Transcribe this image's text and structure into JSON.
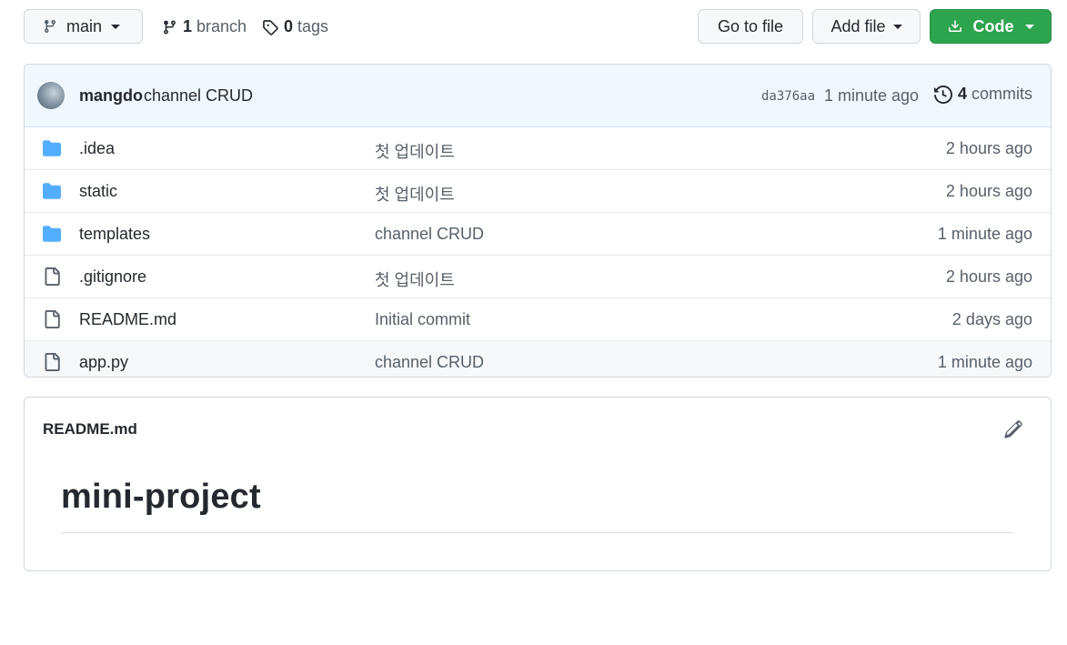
{
  "toolbar": {
    "branch_label": "main",
    "branches_count": "1",
    "branches_label": "branch",
    "tags_count": "0",
    "tags_label": "tags",
    "goto_file_label": "Go to file",
    "add_file_label": "Add file",
    "code_label": "Code"
  },
  "commit": {
    "author": "mangdo",
    "message": "channel CRUD",
    "sha": "da376aa",
    "time": "1 minute ago",
    "count": "4",
    "count_label": "commits"
  },
  "files": [
    {
      "type": "folder",
      "name": ".idea",
      "message": "첫 업데이트",
      "time": "2 hours ago"
    },
    {
      "type": "folder",
      "name": "static",
      "message": "첫 업데이트",
      "time": "2 hours ago"
    },
    {
      "type": "folder",
      "name": "templates",
      "message": "channel CRUD",
      "time": "1 minute ago"
    },
    {
      "type": "file",
      "name": ".gitignore",
      "message": "첫 업데이트",
      "time": "2 hours ago"
    },
    {
      "type": "file",
      "name": "README.md",
      "message": "Initial commit",
      "time": "2 days ago"
    },
    {
      "type": "file",
      "name": "app.py",
      "message": "channel CRUD",
      "time": "1 minute ago"
    }
  ],
  "readme": {
    "title": "README.md",
    "heading": "mini-project"
  },
  "colors": {
    "primary_button": "#2da44e",
    "folder_icon": "#54aeff",
    "commit_header_bg": "#f0f8ff"
  }
}
